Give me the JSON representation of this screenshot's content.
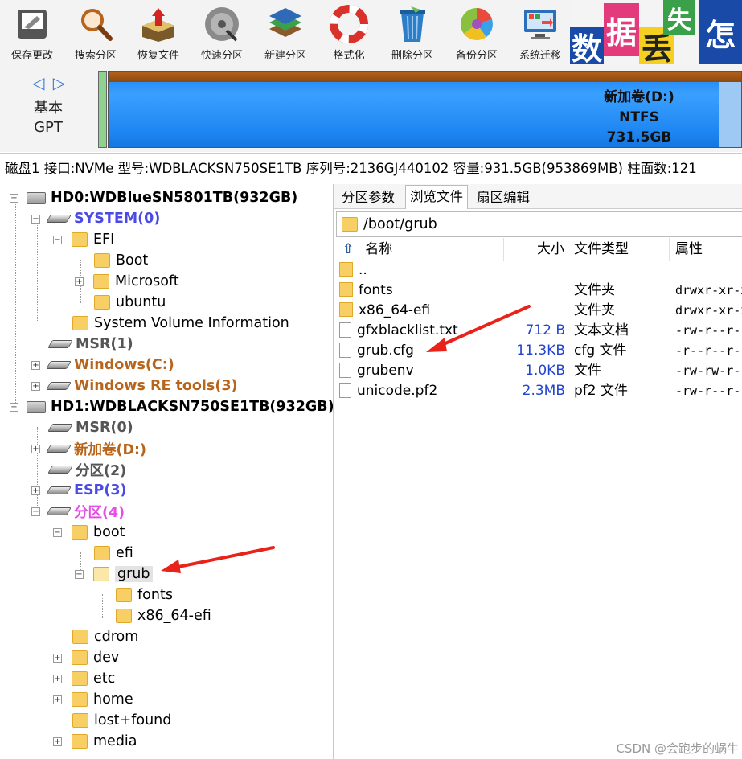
{
  "toolbar": {
    "buttons": [
      {
        "label": "保存更改",
        "icon": "save-icon"
      },
      {
        "label": "搜索分区",
        "icon": "magnifier-icon"
      },
      {
        "label": "恢复文件",
        "icon": "recover-box-icon"
      },
      {
        "label": "快速分区",
        "icon": "disk-icon"
      },
      {
        "label": "新建分区",
        "icon": "layers-icon"
      },
      {
        "label": "格式化",
        "icon": "lifebuoy-icon"
      },
      {
        "label": "删除分区",
        "icon": "trash-icon"
      },
      {
        "label": "备份分区",
        "icon": "pie-icon"
      },
      {
        "label": "系统迁移",
        "icon": "monitor-icon"
      }
    ],
    "banner": [
      "数",
      "据",
      "丢",
      "失",
      "怎"
    ]
  },
  "disk_map": {
    "nav": "◁ ▷",
    "type_line1": "基本",
    "type_line2": "GPT",
    "partition": {
      "name": "新加卷(D:)",
      "fs": "NTFS",
      "size": "731.5GB"
    }
  },
  "disk_info": "磁盘1 接口:NVMe  型号:WDBLACKSN750SE1TB  序列号:2136GJ440102  容量:931.5GB(953869MB)  柱面数:121",
  "tree": {
    "hd0": "HD0:WDBlueSN5801TB(932GB)",
    "system": "SYSTEM(0)",
    "efi": "EFI",
    "boot1": "Boot",
    "microsoft": "Microsoft",
    "ubuntu": "ubuntu",
    "svi": "System Volume Information",
    "msr1": "MSR(1)",
    "windows": "Windows(C:)",
    "winre": "Windows RE tools(3)",
    "hd1": "HD1:WDBLACKSN750SE1TB(932GB)",
    "msr0": "MSR(0)",
    "newvol": "新加卷(D:)",
    "part2": "分区(2)",
    "esp": "ESP(3)",
    "part4": "分区(4)",
    "boot": "boot",
    "efi2": "efi",
    "grub": "grub",
    "fonts": "fonts",
    "x86": "x86_64-efi",
    "cdrom": "cdrom",
    "dev": "dev",
    "etc": "etc",
    "home": "home",
    "lostfound": "lost+found",
    "media": "media"
  },
  "tabs": [
    "分区参数",
    "浏览文件",
    "扇区编辑"
  ],
  "path": "/boot/grub",
  "columns": {
    "name": "名称",
    "size": "大小",
    "type": "文件类型",
    "attr": "属性"
  },
  "files": [
    {
      "name": "..",
      "size": "",
      "type": "",
      "attr": "",
      "kind": "folder"
    },
    {
      "name": "fonts",
      "size": "",
      "type": "文件夹",
      "attr": "drwxr-xr-x",
      "kind": "folder"
    },
    {
      "name": "x86_64-efi",
      "size": "",
      "type": "文件夹",
      "attr": "drwxr-xr-x",
      "kind": "folder"
    },
    {
      "name": "gfxblacklist.txt",
      "size": "712 B",
      "type": "文本文档",
      "attr": "-rw-r--r--",
      "kind": "file"
    },
    {
      "name": "grub.cfg",
      "size": "11.3KB",
      "type": "cfg 文件",
      "attr": "-r--r--r--",
      "kind": "file"
    },
    {
      "name": "grubenv",
      "size": "1.0KB",
      "type": "文件",
      "attr": "-rw-rw-r--",
      "kind": "file"
    },
    {
      "name": "unicode.pf2",
      "size": "2.3MB",
      "type": "pf2 文件",
      "attr": "-rw-r--r--",
      "kind": "file"
    }
  ],
  "watermark": "CSDN @会跑步的蜗牛",
  "colors": {
    "accent": "#1e86f2",
    "annotation_arrow": "#e8231a"
  }
}
